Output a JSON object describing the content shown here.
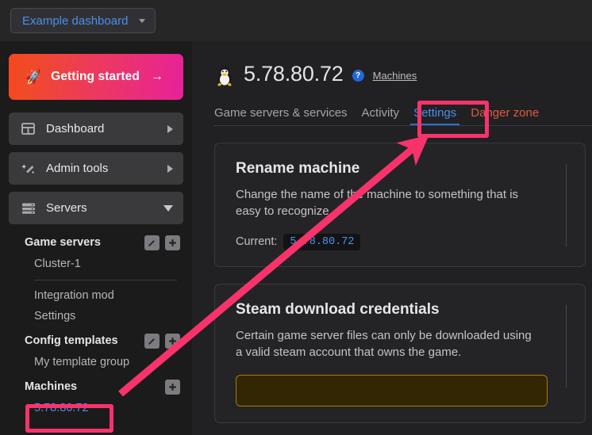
{
  "topbar": {
    "dashboard_select": {
      "label": "Example dashboard",
      "caret_icon": "chevron-down-icon"
    }
  },
  "sidebar": {
    "getting_started": {
      "label": "Getting started",
      "rocket_icon": "rocket-icon",
      "arrow_icon": "arrow-right-icon",
      "gradient_from": "#f4481f",
      "gradient_to": "#e8219a"
    },
    "nav_items": [
      {
        "label": "Dashboard",
        "icon": "grid-icon",
        "expander": "chevron-right-icon",
        "expanded": false
      },
      {
        "label": "Admin tools",
        "icon": "magic-wand-icon",
        "expander": "chevron-right-icon",
        "expanded": false
      },
      {
        "label": "Servers",
        "icon": "server-stack-icon",
        "expander": "chevron-down-icon",
        "expanded": true
      }
    ],
    "groups": [
      {
        "title": "Game servers",
        "edit_icon": "pencil-icon",
        "add_icon": "plus-icon",
        "items": [
          "Cluster-1"
        ]
      },
      {
        "title": "Config templates",
        "edit_icon": "pencil-icon",
        "add_icon": "plus-icon",
        "items": [
          "My template group"
        ]
      }
    ],
    "standalone_items": [
      "Integration mod",
      "Settings"
    ],
    "machines": {
      "title": "Machines",
      "add_icon": "plus-icon",
      "items": [
        "5.78.80.72"
      ]
    }
  },
  "main": {
    "header": {
      "os_icon": "linux-penguin-icon",
      "title": "5.78.80.72",
      "help_icon": "help-circle-icon",
      "help_symbol": "?",
      "breadcrumb_link": "Machines"
    },
    "tabs": [
      {
        "label": "Game servers & services",
        "state": "inactive"
      },
      {
        "label": "Activity",
        "state": "inactive"
      },
      {
        "label": "Settings",
        "state": "active"
      },
      {
        "label": "Danger zone",
        "state": "danger"
      }
    ],
    "cards": [
      {
        "title": "Rename machine",
        "description": "Change the name of the machine to something that is easy to recognize.",
        "current_label": "Current:",
        "current_value": "5.78.80.72"
      },
      {
        "title": "Steam download credentials",
        "description": "Certain game server files can only be downloaded using a valid steam account that owns the game."
      }
    ]
  },
  "annotations": {
    "highlight_color": "#f8336c",
    "boxes": [
      {
        "target": "settings-tab"
      },
      {
        "target": "sidebar-machine-ip"
      }
    ],
    "arrow": {
      "from": "sidebar-machine-ip",
      "to": "settings-tab"
    }
  }
}
